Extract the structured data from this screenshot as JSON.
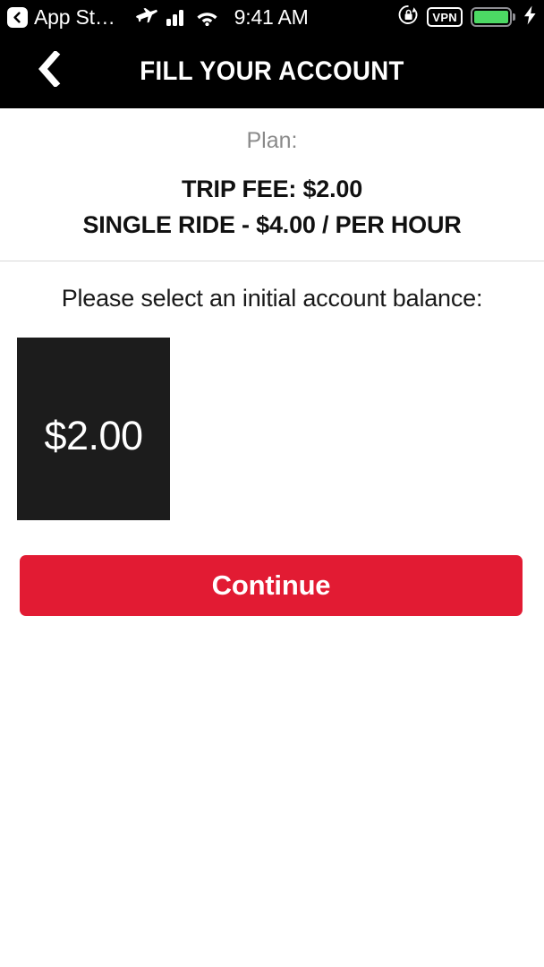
{
  "status_bar": {
    "back_app_label": "App St…",
    "back_icon": "back-chevron-badge-icon",
    "airplane_icon": "airplane-mode-icon",
    "signal_icon": "cellular-signal-icon",
    "wifi_icon": "wifi-icon",
    "time": "9:41 AM",
    "rotation_lock_icon": "rotation-lock-icon",
    "vpn_label": "VPN",
    "battery_icon": "battery-full-icon",
    "charging_icon": "charging-bolt-icon",
    "battery_color": "#4cd964",
    "background_color": "#000000"
  },
  "nav": {
    "back_icon": "chevron-left-icon",
    "title": "FILL YOUR ACCOUNT",
    "background_color": "#000000"
  },
  "plan": {
    "label": "Plan:",
    "lines": [
      "TRIP FEE: $2.00",
      "SINGLE RIDE - $4.00 / PER HOUR"
    ]
  },
  "balance": {
    "prompt": "Please select an initial account balance:",
    "options": [
      {
        "label": "$2.00",
        "selected": true
      }
    ]
  },
  "actions": {
    "continue_label": "Continue",
    "continue_color": "#e21b33"
  }
}
